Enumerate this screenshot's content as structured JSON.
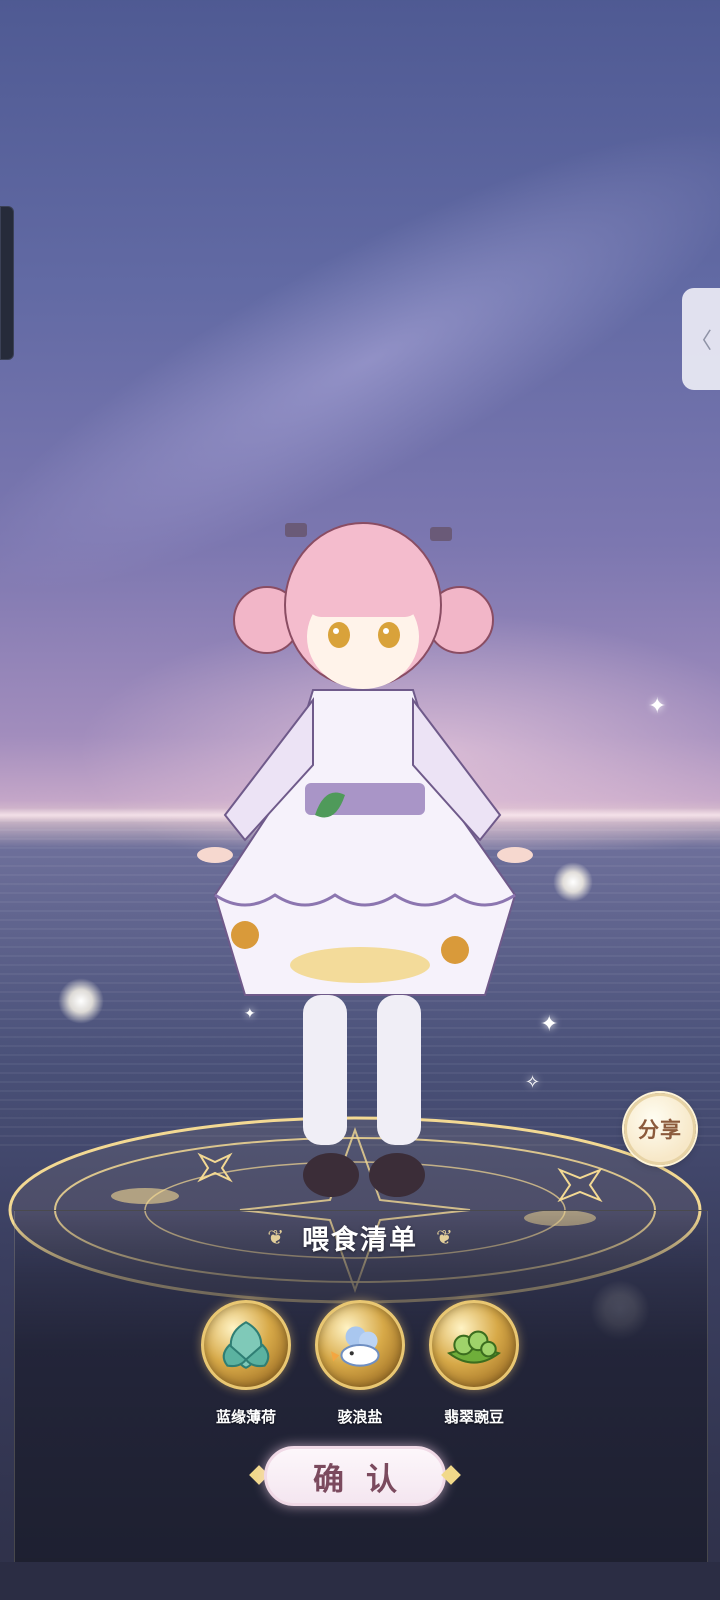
{
  "side_tab": {
    "icon": "chevron-left-icon",
    "glyph": "〈"
  },
  "share": {
    "label": "分享"
  },
  "feed_panel": {
    "title": "喂食清单",
    "items": [
      {
        "name": "蓝缘薄荷",
        "icon": "mint-leaf-icon"
      },
      {
        "name": "骇浪盐",
        "icon": "salt-bird-icon"
      },
      {
        "name": "翡翠豌豆",
        "icon": "green-pea-icon"
      }
    ],
    "confirm_label": "确认"
  },
  "colors": {
    "panel_gold": "#e9c772",
    "confirm_text": "#7b4a5e",
    "share_text": "#8b5a3c"
  }
}
